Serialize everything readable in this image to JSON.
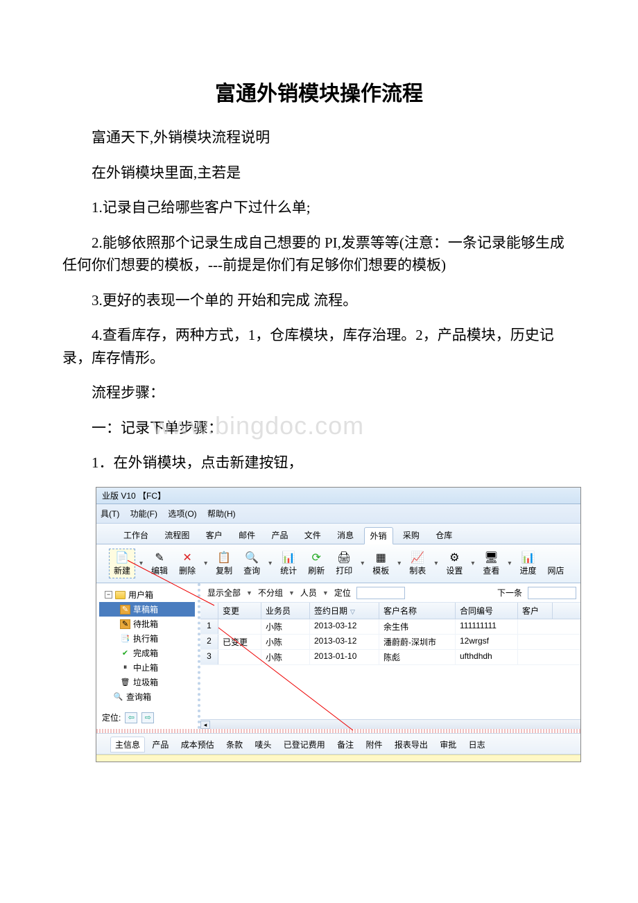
{
  "title": "富通外销模块操作流程",
  "intro1": "富通天下,外销模块流程说明",
  "intro2": "在外销模块里面,主若是",
  "p1": "1.记录自己给哪些客户下过什么单;",
  "p2": "2.能够依照那个记录生成自己想要的 PI,发票等等(注意：一条记录能够生成任何你们想要的模板，---前提是你们有足够你们想要的模板)",
  "p3": "3.更好的表现一个单的 开始和完成 流程。",
  "p4": "4.查看库存，两种方式，1，仓库模块，库存治理。2，产品模块，历史记录，库存情形。",
  "steps": "流程步骤：",
  "s1": "一：记录下单步骤：",
  "s1_1": "1．在外销模块，点击新建按钮，",
  "watermark": "www.bingdoc.com",
  "app": {
    "titlebar": "业版 V10 【FC】",
    "menu": {
      "m1": "具(T)",
      "m2": "功能(F)",
      "m3": "选项(O)",
      "m4": "帮助(H)"
    },
    "tabs": {
      "t1": "工作台",
      "t2": "流程图",
      "t3": "客户",
      "t4": "邮件",
      "t5": "产品",
      "t6": "文件",
      "t7": "消息",
      "t8": "外销",
      "t9": "采购",
      "t10": "仓库"
    },
    "toolbar": {
      "b1": "新建",
      "b2": "编辑",
      "b3": "删除",
      "b4": "复制",
      "b5": "查询",
      "b6": "统计",
      "b7": "刷新",
      "b8": "打印",
      "b9": "模板",
      "b10": "制表",
      "b11": "设置",
      "b12": "查看",
      "b13": "进度",
      "b14": "网店"
    },
    "tree": {
      "root": "用户箱",
      "i1": "草稿箱",
      "i2": "待批箱",
      "i3": "执行箱",
      "i4": "完成箱",
      "i5": "中止箱",
      "i6": "垃圾箱",
      "i7": "查询箱"
    },
    "loc_label": "定位:",
    "filter": {
      "f1": "显示全部",
      "f2": "不分组",
      "f3": "人员",
      "f4": "定位",
      "f5": "下一条"
    },
    "grid": {
      "h1": "变更",
      "h2": "业务员",
      "h3": "签约日期",
      "h4": "客户名称",
      "h5": "合同编号",
      "h6": "客户",
      "rows": [
        {
          "n": "1",
          "c1": "",
          "c2": "小陈",
          "c3": "2013-03-12",
          "c4": "余生伟",
          "c5": "111111111"
        },
        {
          "n": "2",
          "c1": "已变更",
          "c2": "小陈",
          "c3": "2013-03-12",
          "c4": "潘蔚蔚-深圳市",
          "c5": "12wrgsf"
        },
        {
          "n": "3",
          "c1": "",
          "c2": "小陈",
          "c3": "2013-01-10",
          "c4": "陈彪",
          "c5": "ufthdhdh"
        }
      ]
    },
    "btabs": {
      "t1": "主信息",
      "t2": "产品",
      "t3": "成本预估",
      "t4": "条款",
      "t5": "唛头",
      "t6": "已登记费用",
      "t7": "备注",
      "t8": "附件",
      "t9": "报表导出",
      "t10": "审批",
      "t11": "日志"
    }
  }
}
